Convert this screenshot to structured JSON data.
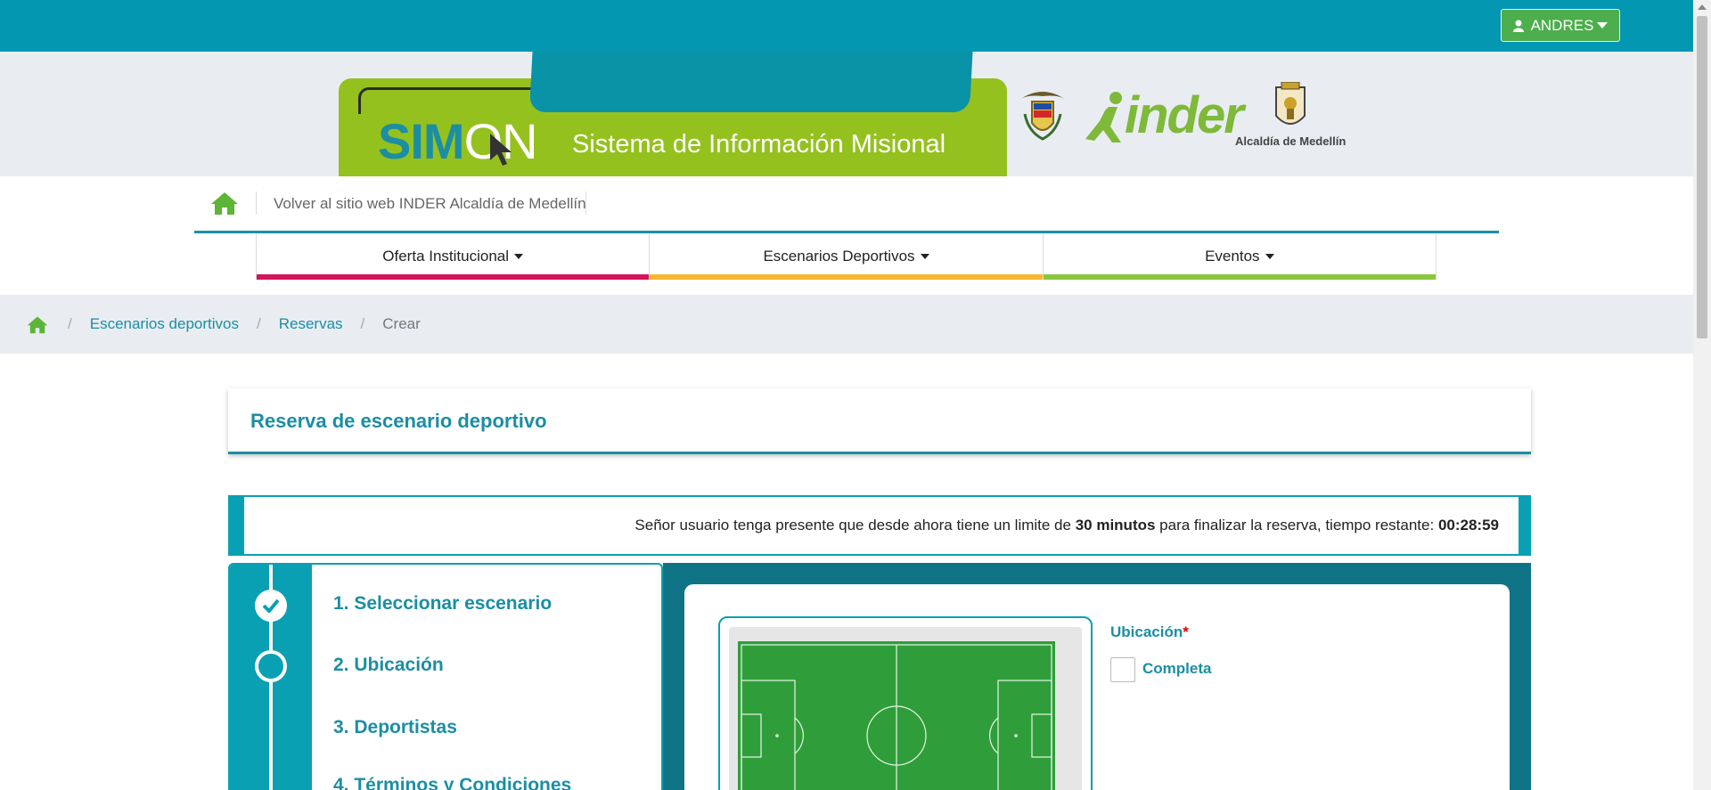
{
  "user": {
    "name": "ANDRES"
  },
  "banner": {
    "logo_sim": "SIM",
    "logo_on": "ON",
    "subtitle": "Sistema de Información Misional",
    "inder": "inder",
    "medellin": "Alcaldía de Medellín"
  },
  "sitenav": {
    "back_link": "Volver al sitio web INDER Alcaldía de Medellín"
  },
  "menu": [
    {
      "label": "Oferta Institucional",
      "color": "#d4145a"
    },
    {
      "label": "Escenarios Deportivos",
      "color": "#f7b731"
    },
    {
      "label": "Eventos",
      "color": "#8cc63f"
    }
  ],
  "breadcrumb": {
    "items": [
      "Escenarios deportivos",
      "Reservas"
    ],
    "current": "Crear"
  },
  "card": {
    "title": "Reserva de escenario deportivo"
  },
  "alert": {
    "text_before": "Señor usuario tenga presente que desde ahora tiene un limite de ",
    "limit": "30 minutos",
    "text_middle": " para finalizar la reserva, tiempo restante: ",
    "time_left": "00:28:59"
  },
  "steps": [
    {
      "label": "1. Seleccionar escenario",
      "done": true
    },
    {
      "label": "2. Ubicación",
      "done": false
    },
    {
      "label": "3. Deportistas"
    },
    {
      "label": "4. Términos y Condiciones"
    }
  ],
  "location": {
    "label": "Ubicación",
    "required_mark": "*",
    "option": "Completa",
    "checked": false
  },
  "colors": {
    "primary": "#0397b2",
    "accent": "#1b8ea3",
    "green": "#95c11f",
    "success": "#4cae4c"
  }
}
